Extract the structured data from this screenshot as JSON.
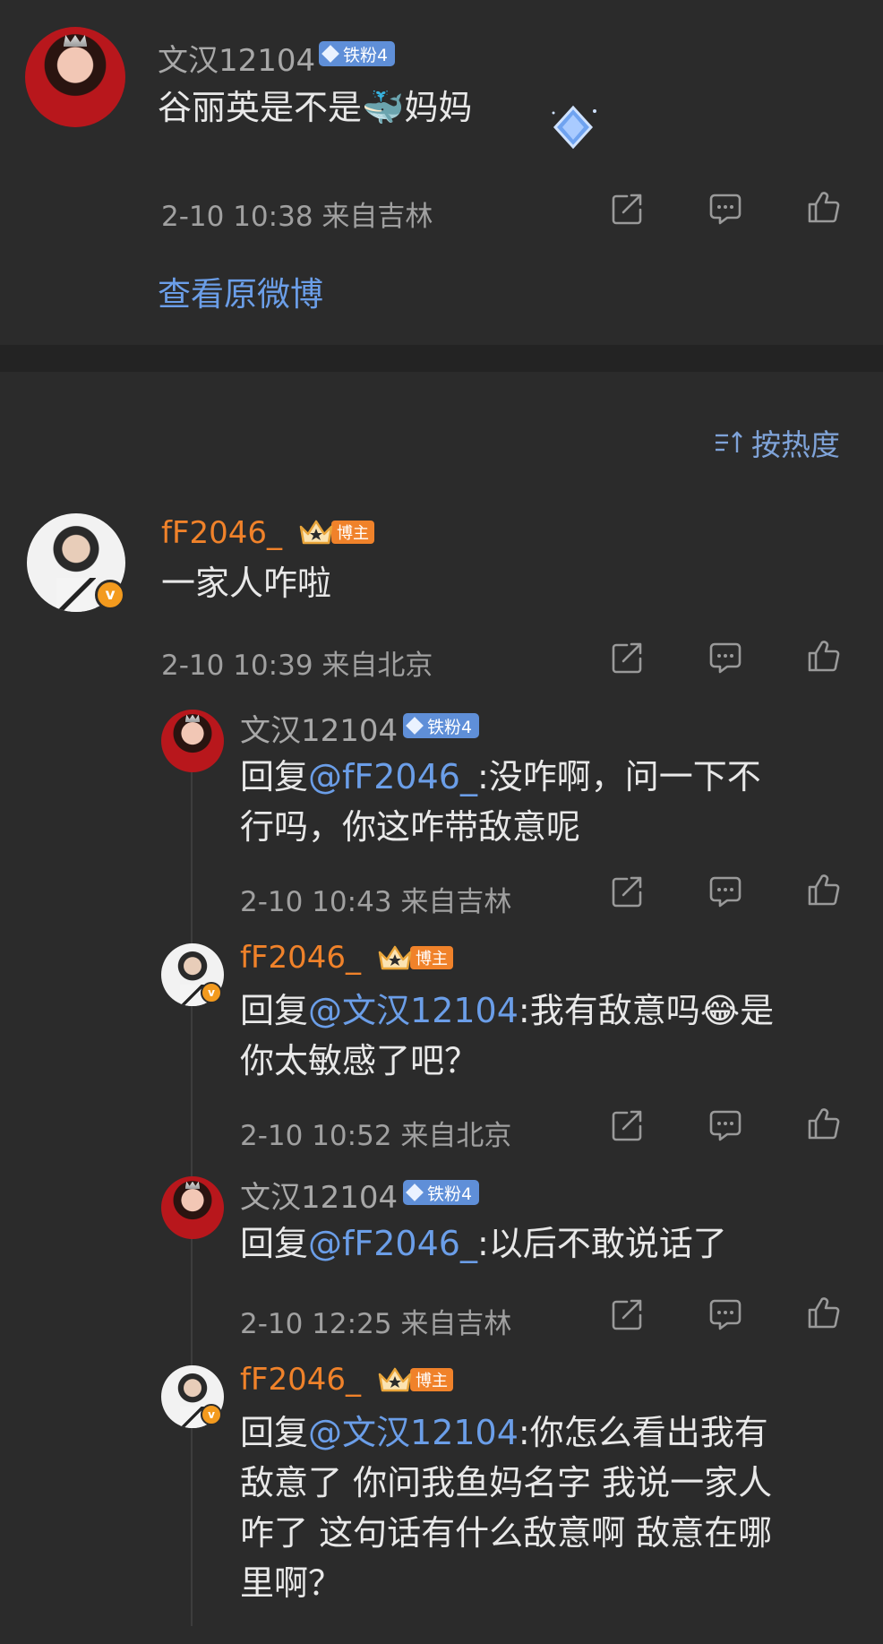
{
  "original_post": {
    "username": "文汉12104",
    "fan_badge": "铁粉4",
    "text_before": "谷丽英是不是",
    "emoji": "🐳",
    "text_after": "妈妈",
    "meta": "2-10 10:38  来自吉林",
    "view_original": "查看原微博"
  },
  "sort": {
    "label": "按热度",
    "icon": "sort-icon"
  },
  "main_comment": {
    "username": "fF2046_",
    "badge_label": "博主",
    "text": "一家人咋啦",
    "meta": "2-10 10:39  来自北京"
  },
  "replies": [
    {
      "username": "文汉12104",
      "fan_badge": "铁粉4",
      "reply_prefix": "回复",
      "mention": "@fF2046_",
      "text_line1": ":没咋啊，问一下不",
      "text_line2": "行吗，你这咋带敌意呢",
      "meta": "2-10 10:43  来自吉林"
    },
    {
      "username": "fF2046_",
      "badge_label": "博主",
      "reply_prefix": "回复",
      "mention": "@文汉12104",
      "text_line1a": ":我有敌意吗",
      "emoji": "😂",
      "text_line1b": "是",
      "text_line2": "你太敏感了吧？",
      "meta": "2-10 10:52  来自北京"
    },
    {
      "username": "文汉12104",
      "fan_badge": "铁粉4",
      "reply_prefix": "回复",
      "mention": "@fF2046_",
      "text_line1": ":以后不敢说话了",
      "meta": "2-10 12:25  来自吉林"
    },
    {
      "username": "fF2046_",
      "badge_label": "博主",
      "reply_prefix": "回复",
      "mention": "@文汉12104",
      "text_line1": ":你怎么看出我有",
      "text_line2": "敌意了 你问我鱼妈名字 我说一家人",
      "text_line3": "咋了 这句话有什么敌意啊 敌意在哪",
      "text_line4": "里啊？"
    }
  ],
  "actions": {
    "icons": [
      "share-icon",
      "comment-icon",
      "like-icon"
    ]
  },
  "colors": {
    "background": "#2b2b2b",
    "divider": "#232323",
    "link_blue": "#6b9ee8",
    "orange": "#f0822a",
    "gray_text": "#a0a0a0",
    "fan_badge_blue": "#5f8fd8"
  }
}
